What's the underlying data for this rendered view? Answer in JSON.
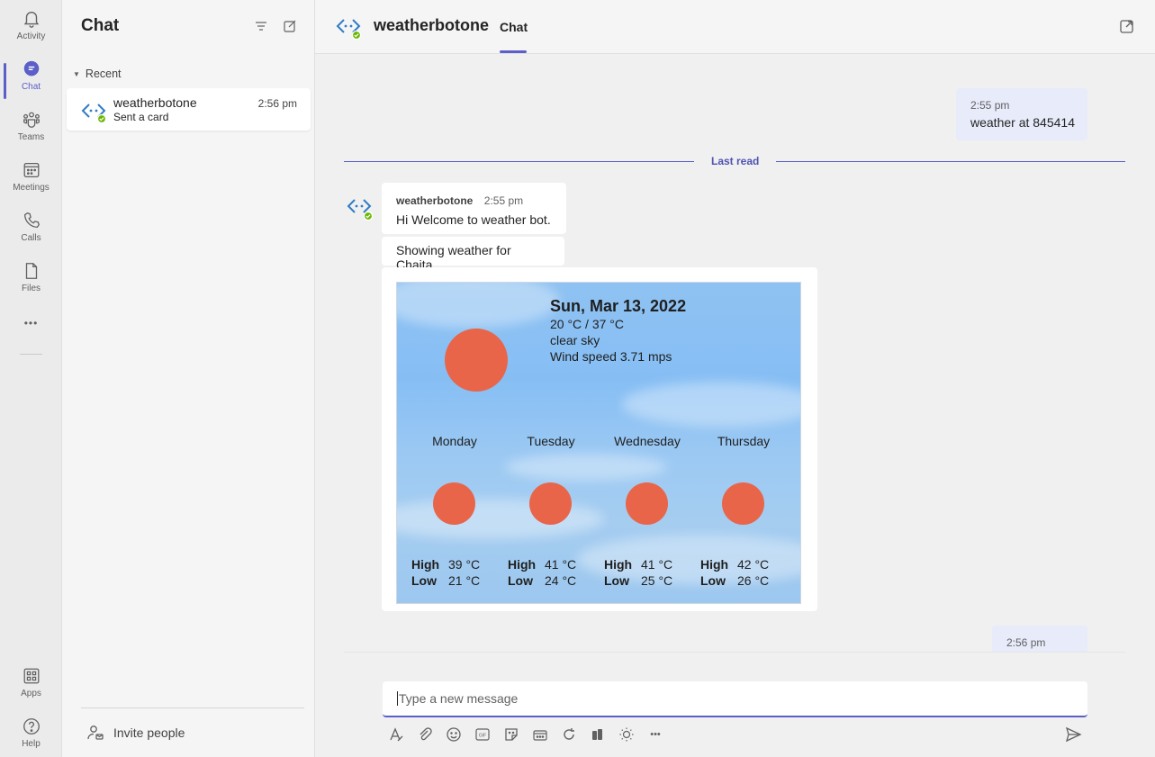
{
  "rail": {
    "items": [
      {
        "label": "Activity"
      },
      {
        "label": "Chat"
      },
      {
        "label": "Teams"
      },
      {
        "label": "Meetings"
      },
      {
        "label": "Calls"
      },
      {
        "label": "Files"
      },
      {
        "label": "Apps"
      },
      {
        "label": "Help"
      }
    ],
    "more": "•••"
  },
  "list": {
    "title": "Chat",
    "section": "Recent",
    "chats": [
      {
        "name": "weatherbotone",
        "preview": "Sent a card",
        "time": "2:56 pm"
      }
    ],
    "invite": "Invite people"
  },
  "header": {
    "name": "weatherbotone",
    "tab": "Chat"
  },
  "messages": {
    "mine1": {
      "time": "2:55 pm",
      "text": "weather at 845414"
    },
    "last_read": "Last read",
    "bot": {
      "sender": "weatherbotone",
      "time": "2:55 pm",
      "text1": "Hi Welcome to weather bot.",
      "text2": "Showing weather for Chaita"
    },
    "mine2": {
      "time": "2:56 pm"
    }
  },
  "card": {
    "date": "Sun, Mar 13, 2022",
    "temp": "20 °C / 37 °C",
    "condition": "clear sky",
    "wind": "Wind speed 3.71 mps",
    "high_label": "High",
    "low_label": "Low",
    "days": [
      {
        "name": "Monday",
        "high": "39 °C",
        "low": "21 °C"
      },
      {
        "name": "Tuesday",
        "high": "41 °C",
        "low": "24 °C"
      },
      {
        "name": "Wednesday",
        "high": "41 °C",
        "low": "25 °C"
      },
      {
        "name": "Thursday",
        "high": "42 °C",
        "low": "26 °C"
      }
    ]
  },
  "compose": {
    "placeholder": "Type a new message",
    "more": "•••"
  },
  "colors": {
    "accent": "#5b5fc7",
    "sun": "#e8654a",
    "status_green": "#6bb700"
  }
}
